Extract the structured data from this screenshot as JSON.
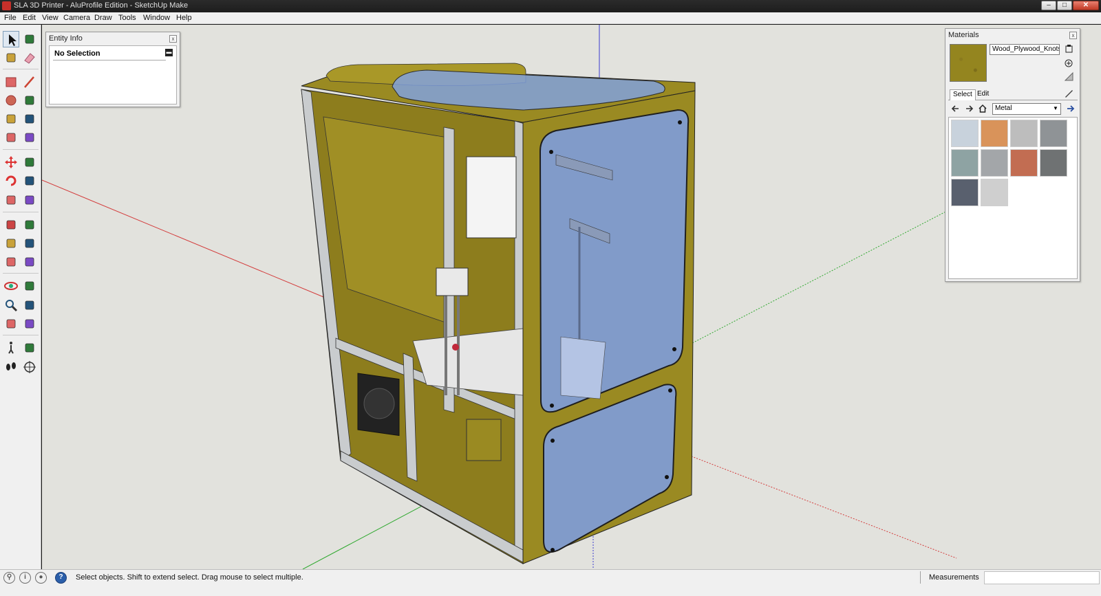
{
  "window": {
    "title": "SLA 3D Printer - AluProfile Edition - SketchUp Make",
    "min_glyph": "–",
    "max_glyph": "□",
    "close_glyph": "✕"
  },
  "menu": [
    "File",
    "Edit",
    "View",
    "Camera",
    "Draw",
    "Tools",
    "Window",
    "Help"
  ],
  "toolbar": {
    "tools": [
      "select-icon",
      "component-icon",
      "paint-bucket-icon",
      "eraser-icon",
      "rectangle-icon",
      "line-icon",
      "circle-icon",
      "freehand-icon",
      "polygon-icon",
      "arc-icon",
      "pie-icon",
      "arc-2pt-icon",
      "move-icon",
      "push-pull-icon",
      "rotate-icon",
      "follow-me-icon",
      "scale-icon",
      "offset-icon",
      "tape-measure-icon",
      "dimension-icon",
      "protractor-icon",
      "text-icon",
      "axes-icon",
      "3d-text-icon",
      "orbit-icon",
      "pan-icon",
      "zoom-icon",
      "zoom-window-icon",
      "zoom-extents-icon",
      "previous-view-icon",
      "walk-icon",
      "look-around-icon",
      "footprints-icon",
      "position-camera-icon"
    ]
  },
  "entity_info": {
    "title": "Entity Info",
    "selection": "No Selection",
    "close_glyph": "x"
  },
  "materials": {
    "title": "Materials",
    "current_material": "Wood_Plywood_Knots",
    "tabs": [
      "Select",
      "Edit"
    ],
    "category": "Metal",
    "close_glyph": "x",
    "swatches": [
      {
        "name": "metal-swatch-1",
        "color": "#c8d2dc"
      },
      {
        "name": "metal-swatch-2",
        "color": "#d9935a"
      },
      {
        "name": "metal-swatch-3",
        "color": "#bdbdbd"
      },
      {
        "name": "metal-swatch-4",
        "color": "#8f9396"
      },
      {
        "name": "metal-swatch-5",
        "color": "#8ea3a3"
      },
      {
        "name": "metal-swatch-6",
        "color": "#a3a6a9"
      },
      {
        "name": "metal-swatch-7",
        "color": "#c26d52"
      },
      {
        "name": "metal-swatch-8",
        "color": "#6f7273"
      },
      {
        "name": "metal-swatch-9",
        "color": "#59606e"
      },
      {
        "name": "metal-swatch-10",
        "color": "#cfcfcf"
      }
    ]
  },
  "statusbar": {
    "icons": [
      "geo-location-icon",
      "credits-icon",
      "user-icon",
      "help-icon"
    ],
    "message": "Select objects. Shift to extend select. Drag mouse to select multiple.",
    "measurements_label": "Measurements",
    "measurements_value": ""
  },
  "colors": {
    "plywood": "#9a8a22",
    "aluminium": "#c9ccce",
    "acrylic": "#7d9ee6",
    "axis_red": "#d33b3b",
    "axis_green": "#2fa82f",
    "axis_blue": "#3a3ad0",
    "viewport_bg": "#e2e2dd"
  }
}
